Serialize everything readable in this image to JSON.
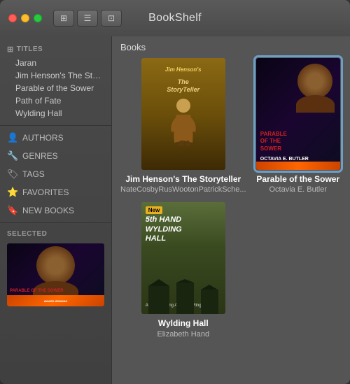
{
  "app": {
    "title": "BookShelf"
  },
  "toolbar": {
    "btn1_label": "⊞",
    "btn2_label": "☰",
    "btn3_label": "⊡"
  },
  "sidebar": {
    "titles_header": "TITLES",
    "books": [
      {
        "label": "Jaran"
      },
      {
        "label": "Jim Henson's The Storyteller"
      },
      {
        "label": "Parable of the Sower"
      },
      {
        "label": "Path of Fate"
      },
      {
        "label": "Wylding Hall"
      }
    ],
    "nav_items": [
      {
        "label": "AUTHORS",
        "icon": "👤"
      },
      {
        "label": "GENRES",
        "icon": "🔧"
      },
      {
        "label": "TAGS",
        "icon": "🏷"
      },
      {
        "label": "FAVORITES",
        "icon": "⭐"
      },
      {
        "label": "NEW BOOKS",
        "icon": "🔖"
      }
    ],
    "selected_label": "Selected"
  },
  "content": {
    "header": "Books",
    "books": [
      {
        "id": "henson",
        "title": "Jim Henson's The Storyteller",
        "author": "NateCosbyRusWootonPatrickSche...",
        "selected": false
      },
      {
        "id": "parable",
        "title": "Parable of the Sower",
        "author": "Octavia E. Butler",
        "selected": true
      },
      {
        "id": "wylding",
        "title": "Wylding Hall",
        "author": "Elizabeth Hand",
        "selected": false
      }
    ]
  }
}
